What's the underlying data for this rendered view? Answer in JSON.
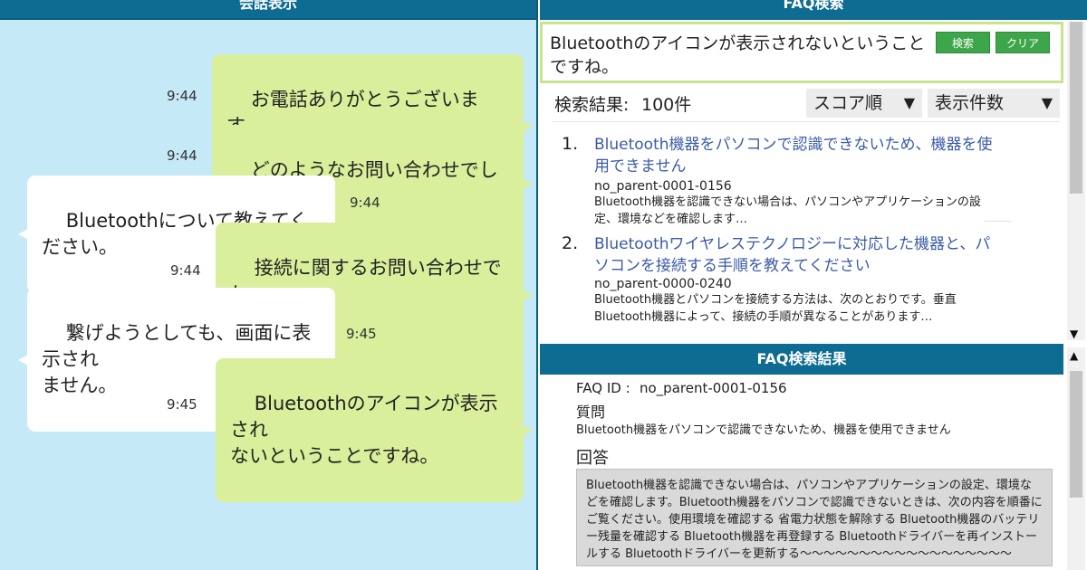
{
  "conversation": {
    "title": "会話表示",
    "messages": [
      {
        "speaker": "operator",
        "text": "お電話ありがとうございます。\nお問い合わせ窓口です。",
        "time": "9:44"
      },
      {
        "speaker": "operator",
        "text": "どのようなお問い合わせでしょうか。",
        "time": "9:44"
      },
      {
        "speaker": "customer",
        "text": "Bluetoothについて教えてください。",
        "time": "9:44"
      },
      {
        "speaker": "operator",
        "text": "接続に関するお問い合わせでしょ\nうか。",
        "time": "9:44"
      },
      {
        "speaker": "customer",
        "text": "繋げようとしても、画面に表示され\nません。",
        "time": "9:45"
      },
      {
        "speaker": "operator",
        "text": "Bluetoothのアイコンが表示され\nないということですね。",
        "time": "9:45"
      }
    ]
  },
  "faq_search": {
    "title": "FAQ検索",
    "query": "Bluetoothのアイコンが表示されないということですね。",
    "search_label": "検索",
    "clear_label": "クリア",
    "result_label": "検索結果:",
    "result_count": "100件",
    "sort_label": "スコア順",
    "count_label": "表示件数",
    "results": [
      {
        "num": "1.",
        "title": "Bluetooth機器をパソコンで認識できないため、機器を使用できません",
        "id": "no_parent-0001-0156",
        "snippet": "Bluetooth機器を認識できない場合は、パソコンやアプリケーションの設定、環境などを確認します…"
      },
      {
        "num": "2.",
        "title": "Bluetoothワイヤレステクノロジーに対応した機器と、パソコンを接続する手順を教えてください",
        "id": "no_parent-0000-0240",
        "snippet": "Bluetooth機器とパソコンを接続する方法は、次のとおりです。垂直Bluetooth機器によって、接続の手順が異なることがあります…"
      }
    ]
  },
  "faq_result": {
    "title": "FAQ検索結果",
    "id_label": "FAQ ID :",
    "id_value": "no_parent-0001-0156",
    "question_label": "質問",
    "question": "Bluetooth機器をパソコンで認識できないため、機器を使用できません",
    "answer_label": "回答",
    "answer": "Bluetooth機器を認識できない場合は、パソコンやアプリケーションの設定、環境などを確認します。Bluetooth機器をパソコンで認識できないときは、次の内容を順番にご覧ください。使用環境を確認する 省電力状態を解除する Bluetooth機器のバッテリー残量を確認する Bluetooth機器を再登録する Bluetoothドライバーを再インストールする Bluetoothドライバーを更新する〜〜〜〜〜〜〜〜〜〜〜〜〜〜〜〜〜〜"
  },
  "colors": {
    "header": "#0e6b92",
    "chat_bg": "#c5e9f7",
    "operator_bubble": "#d9ef9b",
    "customer_bubble": "#ffffff",
    "button": "#3ea64a",
    "link": "#3a5ba8"
  }
}
